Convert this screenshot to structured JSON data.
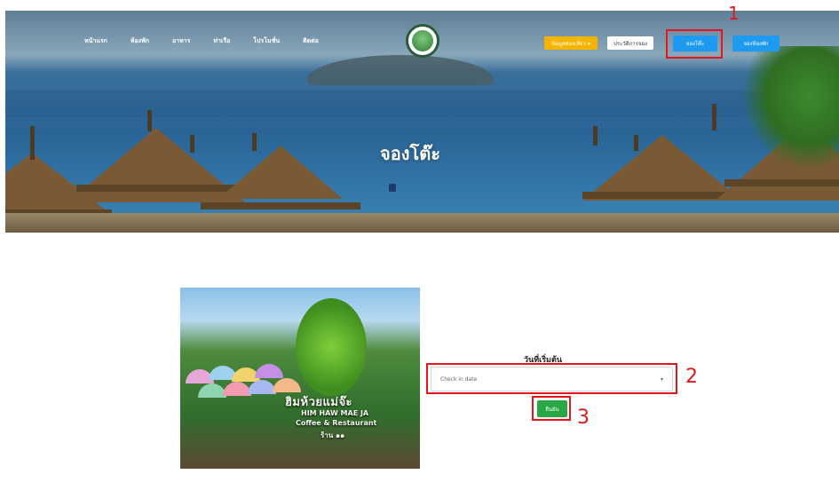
{
  "nav": {
    "items": [
      "หน้าแรก",
      "ห้องพัก",
      "อาหาร",
      "ท่าเรือ",
      "โปรโมชั่น",
      "ติดต่อ"
    ]
  },
  "header": {
    "dropdown_button": "ข้อมูลท่องเที่ยว ▾",
    "secondary_button": "ประวัติการจอง",
    "book_table_button": "จองโต๊ะ",
    "book_room_button": "จองห้องพัก"
  },
  "hero": {
    "title": "จองโต๊ะ"
  },
  "photo_sign": {
    "title": "ฮิมห้วยแม่จ๊ะ",
    "line1": "HIM HAW MAE JA",
    "line2": "Coffee & Restaurant",
    "line3": "ร้าน ๑๑"
  },
  "form": {
    "label": "วันที่เริ่มต้น",
    "select_placeholder": "Check in date",
    "caret": "▾",
    "confirm_button": "ยืนยัน"
  },
  "annotations": [
    "1",
    "2",
    "3"
  ],
  "colors": {
    "annotation_red": "#e4161b",
    "primary_blue": "#1e9bf0",
    "confirm_green": "#27a844",
    "dropdown_yellow": "#f4b400"
  }
}
